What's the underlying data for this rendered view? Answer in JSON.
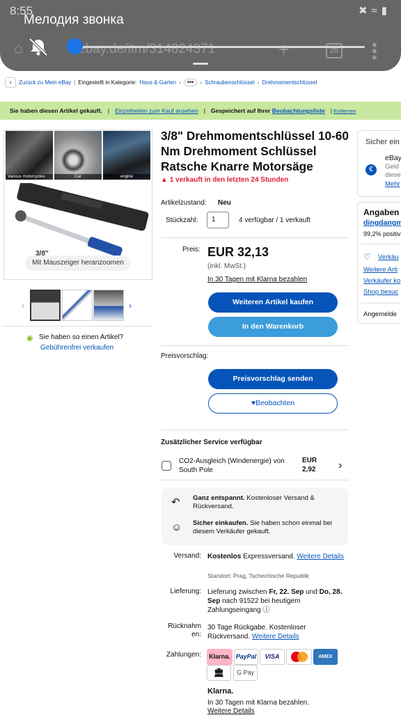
{
  "status_bar": {
    "time": "8:55"
  },
  "volume_panel": {
    "title": "Мелодия звонка",
    "level": 0.05
  },
  "browser": {
    "url": "ebay.de/itm/314824371",
    "tab_count": "29"
  },
  "breadcrumb": {
    "back": "Zurück zu Mein eBay",
    "category_prefix": "Eingestellt in Kategorie:",
    "items": [
      "Haus & Garten",
      "Schraubenschlüssel",
      "Drehmomentschlüssel"
    ]
  },
  "notice": {
    "bought": "Sie haben diesen Artikel gekauft.",
    "details_link": "Einzelheiten zum Kauf ansehen",
    "saved_prefix": "Gespeichert auf Ihrer",
    "watchlist_link": "Beobachtungsliste",
    "remove_link": "Entfernen"
  },
  "gallery": {
    "captions": [
      "Various motorcycles",
      "Car",
      "engine"
    ],
    "zoom_hint": "Mit Mauszeiger heranzoomen",
    "overlay_text": "3/8\""
  },
  "sell": {
    "question": "Sie haben so einen Artikel?",
    "link": "Gebührenfrei verkaufen"
  },
  "product": {
    "title": "3/8\" Drehmomentschlüssel 10-60 Nm Drehmoment Schlüssel Ratsche Knarre Motorsäge",
    "sold_badge": "1 verkauft in den letzten 24 Stunden",
    "condition_label": "Artikelzustand:",
    "condition_value": "Neu",
    "qty_label": "Stückzahl:",
    "qty_value": "1",
    "availability": "4 verfügbar / 1 verkauft",
    "price_label": "Preis:",
    "price": "EUR 32,13",
    "vat": "(inkl. MwSt.)",
    "klarna_link": "In 30 Tagen mit Klarna bezahlen",
    "buy_more": "Weiteren Artikel kaufen",
    "add_cart": "In den Warenkorb",
    "offer_label": "Preisvorschlag:",
    "offer_button": "Preisvorschlag senden",
    "watch_button": "Beobachten"
  },
  "services": {
    "heading": "Zusätzlicher Service verfügbar",
    "co2_label": "CO2-Ausgleich (Windenergie) von South Pole",
    "co2_price_cur": "EUR",
    "co2_price": "2,92"
  },
  "assurance": {
    "returns_bold": "Ganz entspannt.",
    "returns_text": " Kostenloser Versand & Rückversand.",
    "secure_bold": "Sicher einkaufen.",
    "secure_text": " Sie haben schon einmal bei diesem Verkäufer gekauft."
  },
  "shipping": {
    "label": "Versand:",
    "bold": "Kostenlos",
    "text": " Expressversand.",
    "link": "Weitere Details",
    "location": "Standort: Prag, Tschechische Republik"
  },
  "delivery": {
    "label": "Lieferung:",
    "prefix": "Lieferung zwischen ",
    "start": "Fr, 22. Sep",
    "mid": " und ",
    "end": "Do, 28. Sep",
    "suffix": " nach 91522 bei heutigem Zahlungseingang"
  },
  "returns": {
    "label_a": "Rücknahm",
    "label_b": "en:",
    "text": "30 Tage Rückgabe. Kostenloser Rückversand.",
    "link": "Weitere Details"
  },
  "payments": {
    "label": "Zahlungen:",
    "methods": [
      "Klarna.",
      "PayPal",
      "VISA",
      "mastercard",
      "AMEX",
      "bank",
      "G Pay"
    ]
  },
  "klarna_box": {
    "logo": "Klarna.",
    "text": "In 30 Tagen mit Klarna bezahlen.",
    "link": "Weitere Details"
  },
  "right_col": {
    "secure_title": "Sicher ein",
    "ebay_text": "eBay",
    "geld": "Geld",
    "diese": "diese",
    "mehr": "Mehr",
    "seller_title": "Angaben",
    "seller_name": "dingdangmi",
    "feedback": "99,2% positiv",
    "contact": "Verkäu",
    "more_items": "Weitere Arti",
    "seller_contact": "Verkäufer ko",
    "shop": "Shop besuc",
    "signed_in": "Angemelde"
  }
}
